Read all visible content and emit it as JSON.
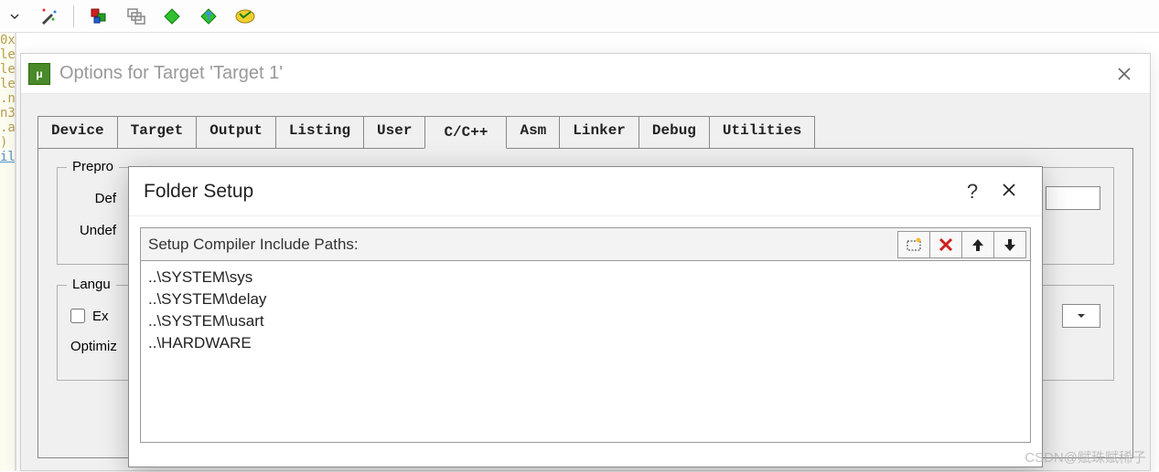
{
  "toolbar": {
    "icons": [
      "wizard-icon",
      "boxes-icon",
      "cascade-icon",
      "diamond-green-icon",
      "diamond-funnel-icon",
      "ellipse-icon"
    ]
  },
  "options_window": {
    "title": "Options for Target 'Target 1'",
    "tabs": [
      "Device",
      "Target",
      "Output",
      "Listing",
      "User",
      "C/C++",
      "Asm",
      "Linker",
      "Debug",
      "Utilities"
    ],
    "active_tab": "C/C++",
    "groupbox_prepro": "Prepro",
    "label_define": "Def",
    "label_undefine": "Undef",
    "groupbox_lang": "Langu",
    "checkbox_ex": "Ex",
    "label_optimize": "Optimiz"
  },
  "folder_dialog": {
    "title": "Folder Setup",
    "header": "Setup Compiler Include Paths:",
    "paths": [
      "..\\SYSTEM\\sys",
      "..\\SYSTEM\\delay",
      "..\\SYSTEM\\usart",
      "..\\HARDWARE"
    ]
  },
  "watermark": "CSDN@赋珠赋稀子"
}
